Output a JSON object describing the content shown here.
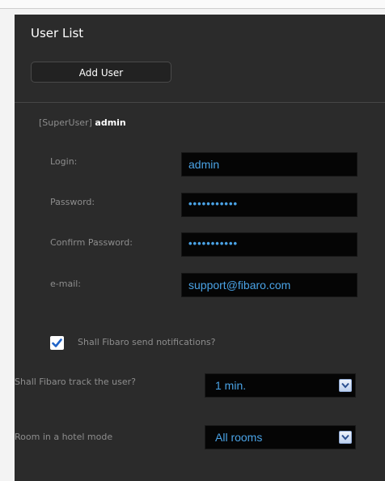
{
  "panel": {
    "title": "User List",
    "add_user_label": "Add User"
  },
  "user": {
    "role_tag": "[SuperUser]",
    "name": "admin",
    "fields": {
      "login_label": "Login:",
      "login_value": "admin",
      "password_label": "Password:",
      "password_value": "•••••••••••",
      "confirm_label": "Confirm Password:",
      "confirm_value": "•••••••••••",
      "email_label": "e-mail:",
      "email_value": "support@fibaro.com"
    }
  },
  "notifications": {
    "label": "Shall Fibaro send notifications?",
    "checked": true
  },
  "tracking": {
    "label": "Shall Fibaro track the user?",
    "selected": "1 min."
  },
  "hotel_mode": {
    "label": "Room in a hotel mode",
    "selected": "All rooms"
  },
  "colors": {
    "panel_bg": "#2b2b2b",
    "input_bg": "#050505",
    "value_text": "#4aa3e6",
    "label_text": "#8d8d8d",
    "checkbox_check": "#1f63c7"
  },
  "icons": {
    "checkbox": "check-icon",
    "dropdown": "chevron-down-icon"
  }
}
